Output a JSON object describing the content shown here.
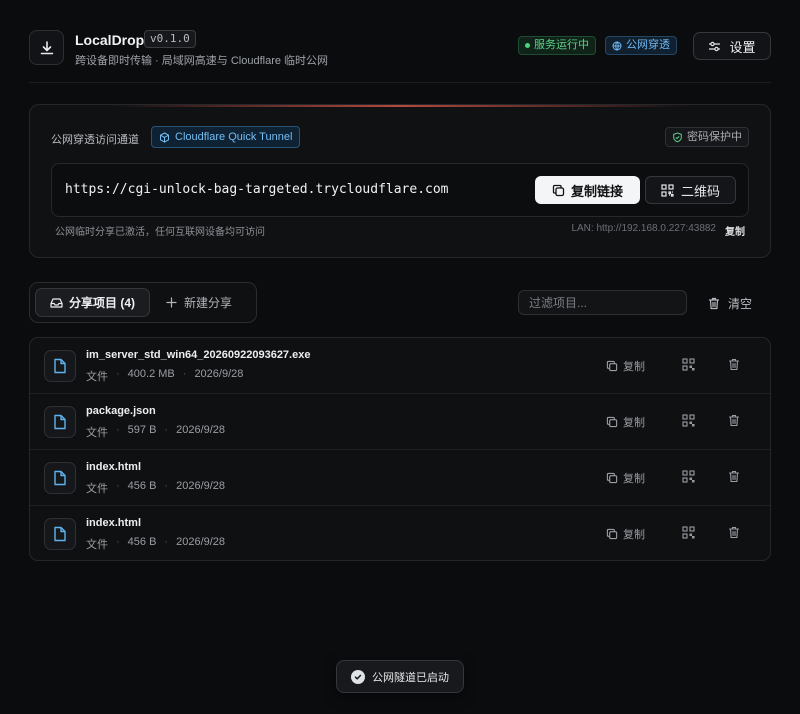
{
  "header": {
    "app_name": "LocalDrop",
    "version": "v0.1.0",
    "subtitle": "跨设备即时传输 · 局域网高速与 Cloudflare 临时公网",
    "status_running": "服务运行中",
    "status_public": "公网穿透",
    "settings_label": "设置"
  },
  "tunnel": {
    "label": "公网穿透访问通道",
    "provider": "Cloudflare Quick Tunnel",
    "password_badge": "密码保护中",
    "url": "https://cgi-unlock-bag-targeted.trycloudflare.com",
    "copy_link_label": "复制链接",
    "qr_label": "二维码",
    "status_text": "公网临时分享已激活，任何互联网设备均可访问",
    "lan_text": "LAN: http://192.168.0.227:43882",
    "lan_copy_label": "复制"
  },
  "tabs": {
    "shared_label": "分享项目 (4)",
    "new_label": "新建分享"
  },
  "filter": {
    "placeholder": "过滤项目..."
  },
  "clear_label": "清空",
  "row_actions": {
    "copy_label": "复制"
  },
  "files": [
    {
      "name": "im_server_std_win64_20260922093627.exe",
      "type": "文件",
      "size": "400.2 MB",
      "date": "2026/9/28"
    },
    {
      "name": "package.json",
      "type": "文件",
      "size": "597 B",
      "date": "2026/9/28"
    },
    {
      "name": "index.html",
      "type": "文件",
      "size": "456 B",
      "date": "2026/9/28"
    },
    {
      "name": "index.html",
      "type": "文件",
      "size": "456 B",
      "date": "2026/9/28"
    }
  ],
  "toast": {
    "message": "公网隧道已启动"
  },
  "colors": {
    "background": "#0b0c0e",
    "running_green": "#5fd08a",
    "accent_blue": "#6fb6ef",
    "file_icon_blue": "#5fb3f0",
    "tunnel_glow": "#b5483d"
  },
  "icons": {
    "logo": "download-icon",
    "settings": "sliders-icon",
    "copy": "copy-icon",
    "qr": "qr-code-icon",
    "delete": "trash-icon",
    "file": "file-icon",
    "clear": "trash-icon",
    "shield": "shield-icon",
    "cloud": "cloud-icon",
    "toast": "check-circle-icon"
  }
}
